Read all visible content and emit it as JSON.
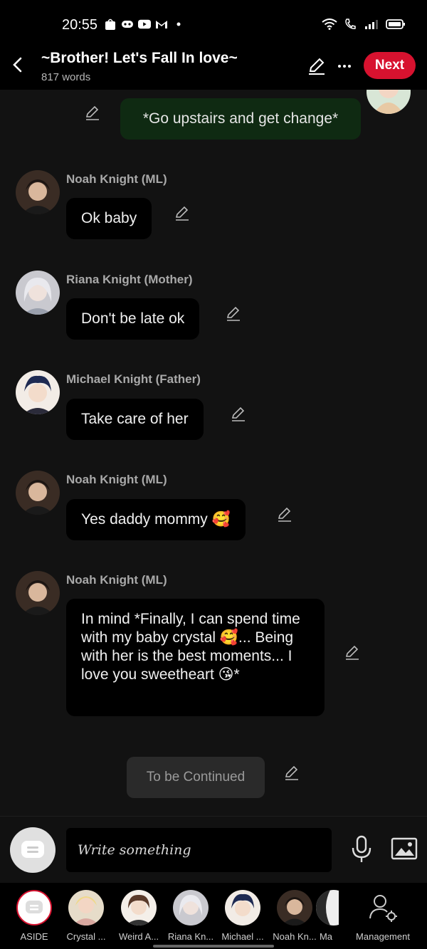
{
  "status": {
    "time": "20:55"
  },
  "header": {
    "title": "~Brother! Let's Fall In love~",
    "word_count": "817 words",
    "next_label": "Next"
  },
  "messages": [
    {
      "speaker": "",
      "text": "*Go upstairs and get change*"
    },
    {
      "speaker": "Noah Knight (ML)",
      "text": "Ok baby"
    },
    {
      "speaker": "Riana Knight (Mother)",
      "text": "Don't be late ok"
    },
    {
      "speaker": "Michael Knight (Father)",
      "text": "Take care of her"
    },
    {
      "speaker": "Noah Knight (ML)",
      "text": "Yes daddy mommy 🥰"
    },
    {
      "speaker": "Noah Knight (ML)",
      "text": "In mind *Finally, I can spend time with my baby crystal 🥰... Being with her is the best moments... I love you sweetheart 😘*"
    }
  ],
  "continued_label": "To be Continued",
  "composer": {
    "placeholder": "Write something"
  },
  "characters": [
    {
      "label": "ASIDE"
    },
    {
      "label": "Crystal ..."
    },
    {
      "label": "Weird A..."
    },
    {
      "label": "Riana Kn..."
    },
    {
      "label": "Michael ..."
    },
    {
      "label": "Noah Kn..."
    },
    {
      "label": "Ma"
    },
    {
      "label": "Management"
    }
  ],
  "colors": {
    "accent": "#d7122f",
    "green_bubble": "#0f2a12",
    "bubble": "#000000"
  }
}
